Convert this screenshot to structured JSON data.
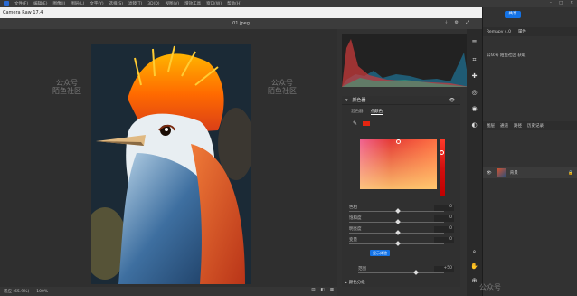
{
  "ps": {
    "menu": [
      "文件(F)",
      "编辑(E)",
      "图像(I)",
      "图层(L)",
      "文字(Y)",
      "选择(S)",
      "滤镜(T)",
      "3D(D)",
      "视图(V)",
      "增效工具",
      "窗口(W)",
      "帮助(H)"
    ],
    "share_label": "共享",
    "panel_tabs": [
      "Remapy 4.0",
      "属性"
    ],
    "sub_label": "公众号 陌鱼社区 获取",
    "layers_tabs": [
      "图层",
      "通道",
      "路径",
      "历史记录"
    ],
    "layer_name": "背景"
  },
  "cr": {
    "title": "Camera Raw 17.4",
    "filename": "01.jpeg",
    "zoom_label": "适应 (65.9%)",
    "zoom_value": "100%",
    "panel_title": "颜色器",
    "tabs": [
      "混色器",
      "点颜色"
    ],
    "sliders": [
      {
        "label": "色相",
        "value": "0"
      },
      {
        "label": "饱和度",
        "value": "0"
      },
      {
        "label": "明亮度",
        "value": "0"
      },
      {
        "label": "变量",
        "value": "0"
      }
    ],
    "button_label": "显示体验",
    "range_label": "范围",
    "range_value": "+50",
    "next_panel": "颜色分级"
  },
  "watermark": {
    "line1": "公众号",
    "line2": "陌鱼社区"
  },
  "colors": {
    "accent": "#1473e6",
    "picked": "#e52510"
  }
}
